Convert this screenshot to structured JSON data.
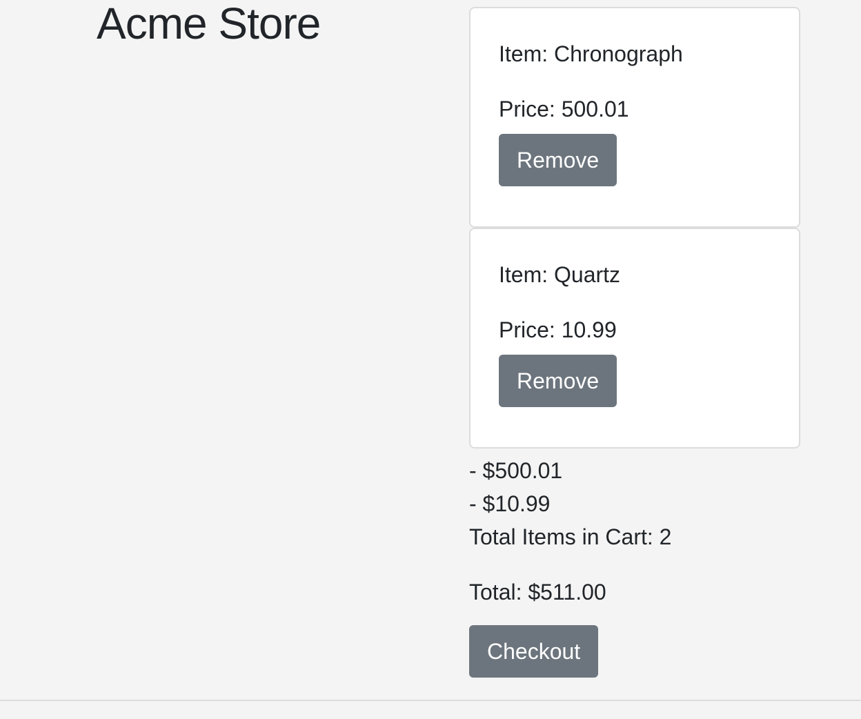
{
  "header": {
    "title": "Acme Store"
  },
  "cart": {
    "items": [
      {
        "item_label": "Item: Chronograph",
        "price_label": "Price: 500.01",
        "remove_label": "Remove"
      },
      {
        "item_label": "Item: Quartz",
        "price_label": "Price: 10.99",
        "remove_label": "Remove"
      }
    ],
    "line_prices": [
      "- $500.01",
      "- $10.99"
    ],
    "total_items": "Total Items in Cart: 2",
    "total": "Total: $511.00",
    "checkout_label": "Checkout"
  },
  "colors": {
    "background": "#f4f4f4",
    "card": "#ffffff",
    "button": "#6c757d",
    "text": "#212529"
  }
}
